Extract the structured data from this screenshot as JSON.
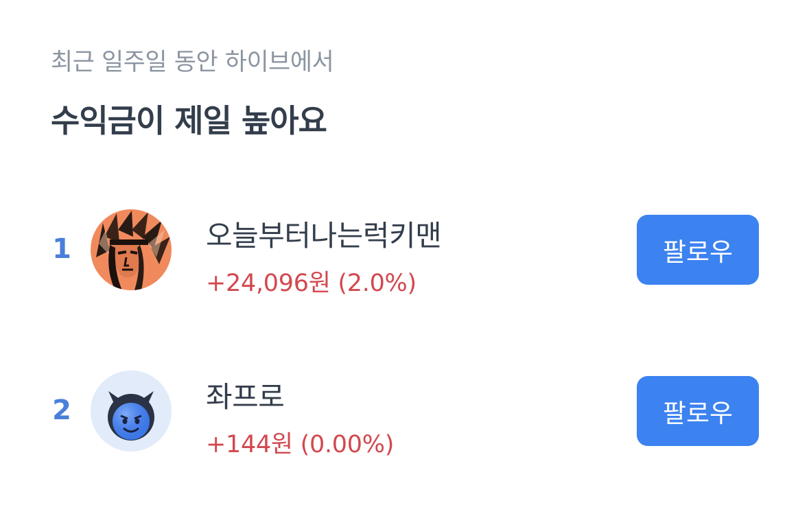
{
  "header": {
    "subtitle": "최근 일주일 동안 하이브에서",
    "title": "수익금이 제일 높아요"
  },
  "ranking": [
    {
      "rank": "1",
      "name": "오늘부터나는럭키맨",
      "profit": "+24,096원 (2.0%)",
      "follow_label": "팔로우",
      "avatar_icon": "portrait-headdress-avatar"
    },
    {
      "rank": "2",
      "name": "좌프로",
      "profit": "+144원 (0.00%)",
      "follow_label": "팔로우",
      "avatar_icon": "blue-devil-avatar"
    }
  ],
  "colors": {
    "rank": "#4a7fd9",
    "profit": "#d2484f",
    "button": "#3c82f0",
    "title": "#333d4b",
    "subtitle": "#8b95a1"
  }
}
